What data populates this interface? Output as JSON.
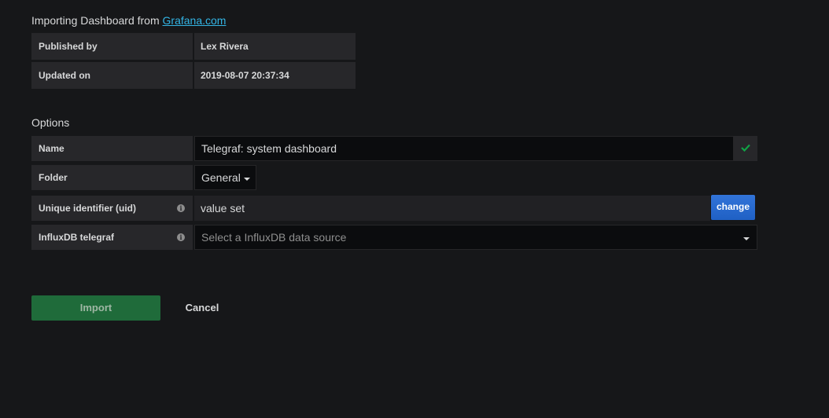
{
  "header": {
    "import_prefix": "Importing Dashboard from ",
    "source_link": "Grafana.com"
  },
  "info": {
    "published_by_label": "Published by",
    "published_by_value": "Lex Rivera",
    "updated_on_label": "Updated on",
    "updated_on_value": "2019-08-07 20:37:34"
  },
  "options": {
    "heading": "Options",
    "name_label": "Name",
    "name_value": "Telegraf: system dashboard",
    "folder_label": "Folder",
    "folder_value": "General",
    "uid_label": "Unique identifier (uid)",
    "uid_value": "value set",
    "change_label": "change",
    "datasource_label": "InfluxDB telegraf",
    "datasource_placeholder": "Select a InfluxDB data source"
  },
  "actions": {
    "import_label": "Import",
    "cancel_label": "Cancel"
  },
  "icons": {
    "valid": "check-icon",
    "info": "info-circle-icon",
    "dropdown": "caret-down-icon"
  },
  "colors": {
    "background": "#161719",
    "link": "#33b5e5",
    "success_check": "#10a345",
    "primary_button": "#1f60c4",
    "import_button": "#1f6b3a"
  }
}
